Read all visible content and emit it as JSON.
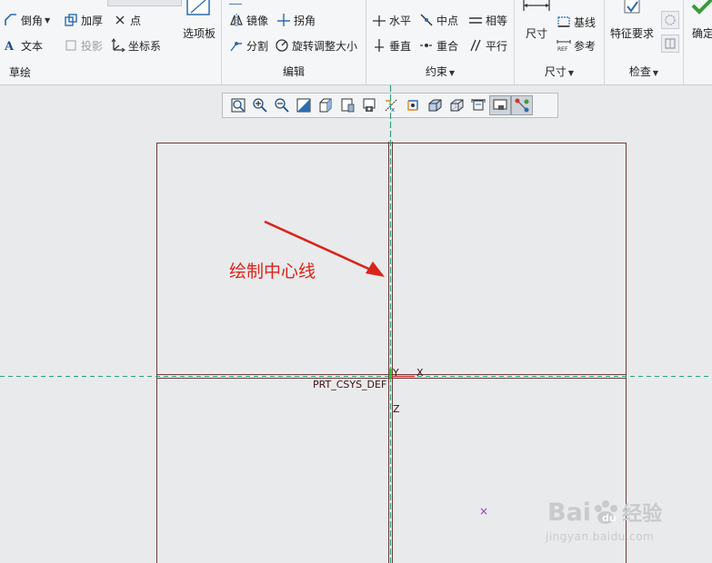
{
  "ribbon": {
    "sketch": {
      "label": "草绘",
      "chamfer": "倒角",
      "thicken": "加厚",
      "point": "点",
      "text": "文本",
      "project": "投影",
      "coord_sys": "坐标系",
      "palette": "选项板"
    },
    "edit": {
      "label": "编辑",
      "mirror": "镜像",
      "corner": "拐角",
      "divide": "分割",
      "rotate_resize": "旋转调整大小"
    },
    "constrain": {
      "label": "约束",
      "horizontal": "水平",
      "midpoint": "中点",
      "equal": "相等",
      "vertical": "垂直",
      "coincident": "重合",
      "parallel": "平行"
    },
    "dimension": {
      "label": "尺寸",
      "dimension": "尺寸",
      "baseline": "基线",
      "reference": "参考"
    },
    "inspect": {
      "label": "检查",
      "feature_req": "特征要求"
    },
    "confirm": "确定"
  },
  "canvas": {
    "y_axis": "Y",
    "x_axis": "X",
    "z_axis": "Z",
    "csys_name": "PRT_CSYS_DEF",
    "annotation": "绘制中心线",
    "point_marker": "×"
  },
  "watermark": {
    "brand": "Bai",
    "brand_tail": "经验",
    "url": "jingyan.baidu.com"
  },
  "colors": {
    "annotation": "#d9241b",
    "centerline": "#2aa37a",
    "frame": "#6e3b3b"
  }
}
